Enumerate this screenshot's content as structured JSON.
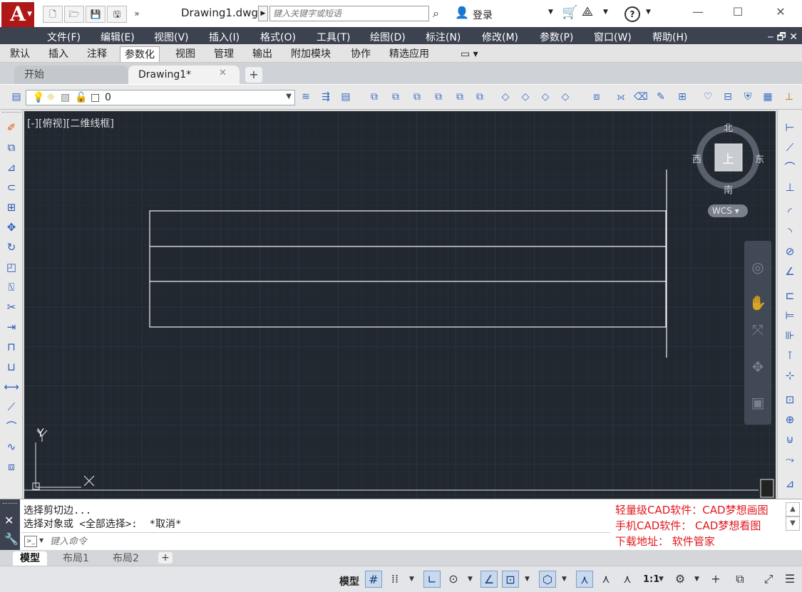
{
  "titlebar": {
    "logo_text": "A",
    "document_title": "Drawing1.dwg",
    "search_placeholder": "键入关键字或短语",
    "login_label": "登录",
    "help_icon": "?"
  },
  "menu": {
    "items": [
      "文件(F)",
      "编辑(E)",
      "视图(V)",
      "插入(I)",
      "格式(O)",
      "工具(T)",
      "绘图(D)",
      "标注(N)",
      "修改(M)",
      "参数(P)",
      "窗口(W)",
      "帮助(H)"
    ]
  },
  "ribbon": {
    "tabs": [
      "默认",
      "插入",
      "注释",
      "参数化",
      "视图",
      "管理",
      "输出",
      "附加模块",
      "协作",
      "精选应用"
    ],
    "active_tab": "参数化"
  },
  "doc_tabs": {
    "start_label": "开始",
    "drawing_label": "Drawing1*"
  },
  "layer": {
    "current_name": "0"
  },
  "viewport": {
    "label": "[-][俯视][二维线框]",
    "compass": {
      "north": "北",
      "south": "南",
      "east": "东",
      "west": "西",
      "top": "上",
      "wcs": "WCS"
    },
    "ucs_x": "X",
    "ucs_y": "Y"
  },
  "command": {
    "history": [
      "选择剪切边...",
      "选择对象或 <全部选择>:  *取消*"
    ],
    "input_placeholder": "键入命令",
    "promo_lines": [
      "轻量级CAD软件：CAD梦想画图",
      "手机CAD软件： CAD梦想看图",
      "下载地址：   软件管家"
    ]
  },
  "layout_tabs": [
    "模型",
    "布局1",
    "布局2"
  ],
  "status": {
    "model_label": "模型",
    "scale_label": "1:1"
  },
  "colors": {
    "canvas": "#212830",
    "menubar": "#3c4250",
    "logo": "#b01818",
    "promo": "#e0181e"
  }
}
